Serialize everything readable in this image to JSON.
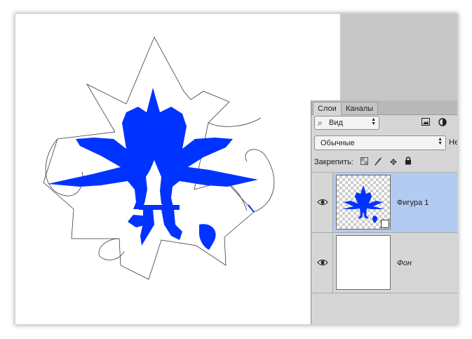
{
  "panel": {
    "tabs": [
      {
        "label": "Слои",
        "active": true
      },
      {
        "label": "Каналы",
        "active": false
      }
    ],
    "filter": {
      "kind_label": "Вид",
      "icons": [
        "search-icon",
        "image-filter-icon",
        "adjustment-filter-icon"
      ]
    },
    "blend_mode": "Обычные",
    "opacity_label": "Не",
    "lock": {
      "label": "Закрепить:",
      "icons": [
        "lock-transparent-pixels-icon",
        "lock-image-pixels-icon",
        "lock-position-icon",
        "lock-all-icon"
      ]
    },
    "layers": [
      {
        "name": "Фигура 1",
        "visible": true,
        "selected": true,
        "italic": false
      },
      {
        "name": "Фон",
        "visible": true,
        "selected": false,
        "italic": true
      }
    ]
  },
  "colors": {
    "shape_fill": "#0033ff",
    "selection_highlight": "#b3cbf0",
    "panel_bg": "#d6d6d6"
  }
}
